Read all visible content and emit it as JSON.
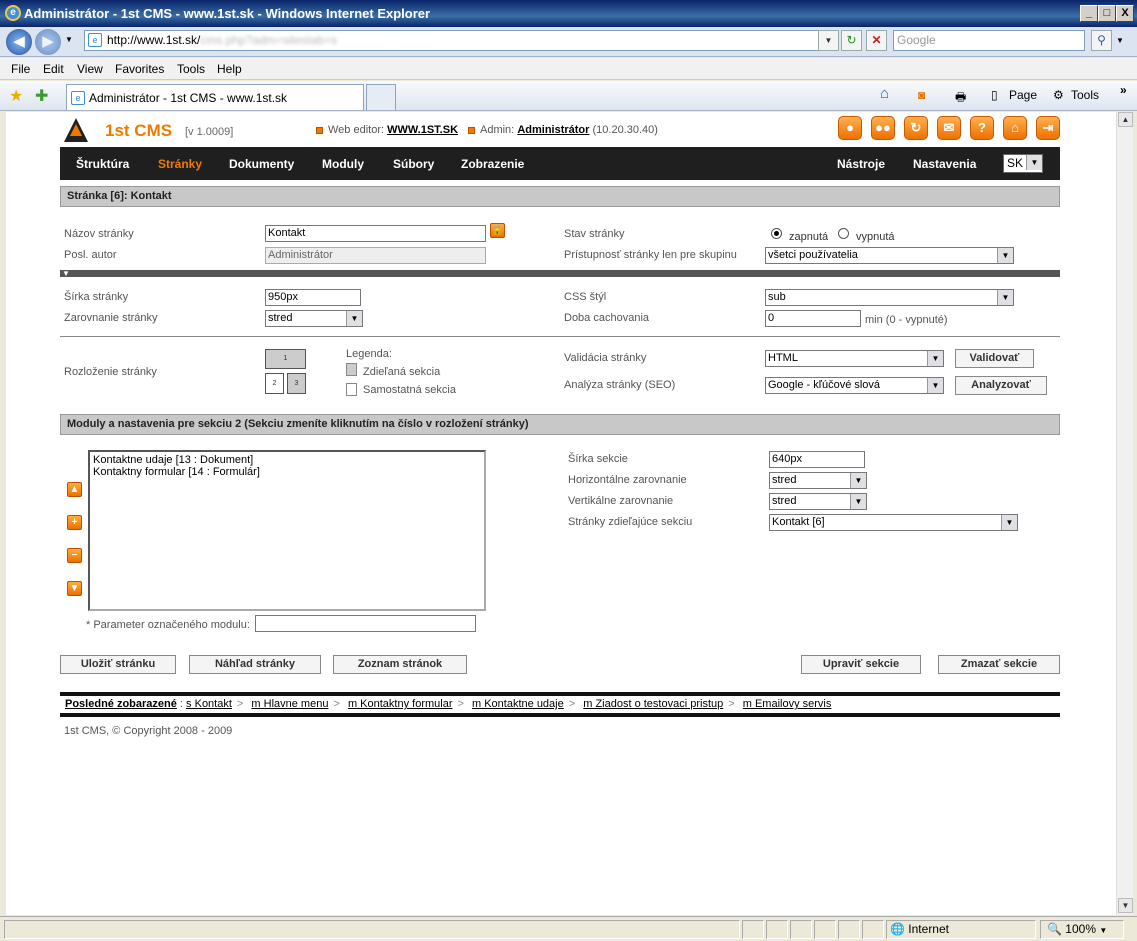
{
  "window": {
    "title": "Administrátor - 1st CMS - www.1st.sk - Windows Internet Explorer",
    "min": "_",
    "max": "□",
    "close": "X"
  },
  "address": {
    "url": "http://www.1st.sk/",
    "url_blurred": "cms.php?adm=sitestab=s",
    "search_placeholder": "Google"
  },
  "menu": {
    "file": "File",
    "edit": "Edit",
    "view": "View",
    "favorites": "Favorites",
    "tools": "Tools",
    "help": "Help"
  },
  "tab": {
    "title": "Administrátor - 1st CMS - www.1st.sk"
  },
  "toolbar": {
    "page": "Page",
    "tools": "Tools"
  },
  "cms": {
    "brand": "1st CMS",
    "version": "[v 1.0009]",
    "web_editor_label": "Web editor:",
    "web_editor_value": "WWW.1ST.SK",
    "admin_label": "Admin:",
    "admin_value": "Administrátor",
    "admin_ip": "(10.20.30.40)",
    "icon_user": "user-icon",
    "icon_users": "users-icon",
    "icon_refresh": "refresh-icon",
    "icon_mail": "mail-icon",
    "icon_help": "?",
    "icon_home": "home-icon",
    "icon_exit": "exit-icon",
    "nav": [
      "Štruktúra",
      "Stránky",
      "Dokumenty",
      "Moduly",
      "Súbory",
      "Zobrazenie"
    ],
    "nav_right": [
      "Nástroje",
      "Nastavenia"
    ],
    "lang": "SK"
  },
  "form": {
    "section_title": "Stránka [6]: Kontakt",
    "name_label": "Názov stránky",
    "name_value": "Kontakt",
    "author_label": "Posl. autor",
    "author_value": "Administrátor",
    "state_label": "Stav stránky",
    "state_on": "zapnutá",
    "state_off": "vypnutá",
    "access_label": "Prístupnosť stránky len pre skupinu",
    "access_value": "všetci používatelia",
    "width_label": "Šírka stránky",
    "width_value": "950px",
    "align_label": "Zarovnanie stránky",
    "align_value": "stred",
    "css_label": "CSS štýl",
    "css_value": "sub",
    "cache_label": "Doba cachovania",
    "cache_value": "0",
    "cache_hint": "min (0 - vypnuté)",
    "layout_label": "Rozloženie stránky",
    "layout_cells": [
      "1",
      "2",
      "3"
    ],
    "legend_title": "Legenda:",
    "legend_shared": "Zdieľaná sekcia",
    "legend_single": "Samostatná sekcia",
    "validation_label": "Validácia stránky",
    "validation_value": "HTML",
    "validate_btn": "Validovať",
    "seo_label": "Analýza stránky (SEO)",
    "seo_value": "Google - kľúčové slová",
    "analyze_btn": "Analyzovať"
  },
  "modules": {
    "section_title": "Moduly a nastavenia pre sekciu 2 (Sekciu zmeníte kliknutím na číslo v rozložení stránky)",
    "items": [
      "Kontaktne udaje [13 : Dokument]",
      "Kontaktny formular [14 : Formulár]"
    ],
    "param_label": "* Parameter označeného modulu:",
    "param_value": "",
    "sec_width_label": "Šírka sekcie",
    "sec_width_value": "640px",
    "h_align_label": "Horizontálne zarovnanie",
    "h_align_value": "stred",
    "v_align_label": "Vertikálne zarovnanie",
    "v_align_value": "stred",
    "shared_label": "Stránky zdieľajúce sekciu",
    "shared_value": "Kontakt [6]"
  },
  "buttons": {
    "save": "Uložiť stránku",
    "preview": "Náhľad stránky",
    "list": "Zoznam stránok",
    "edit_section": "Upraviť sekcie",
    "delete_section": "Zmazať sekcie"
  },
  "recent": {
    "label": "Posledné zobarazené",
    "items": [
      "s Kontakt",
      "m Hlavne menu",
      "m Kontaktny formular",
      "m Kontaktne udaje",
      "m Ziadost o testovaci pristup",
      "m Emailovy servis"
    ]
  },
  "copyright": "1st CMS, © Copyright 2008 - 2009",
  "status": {
    "zone": "Internet",
    "zoom": "100%"
  }
}
